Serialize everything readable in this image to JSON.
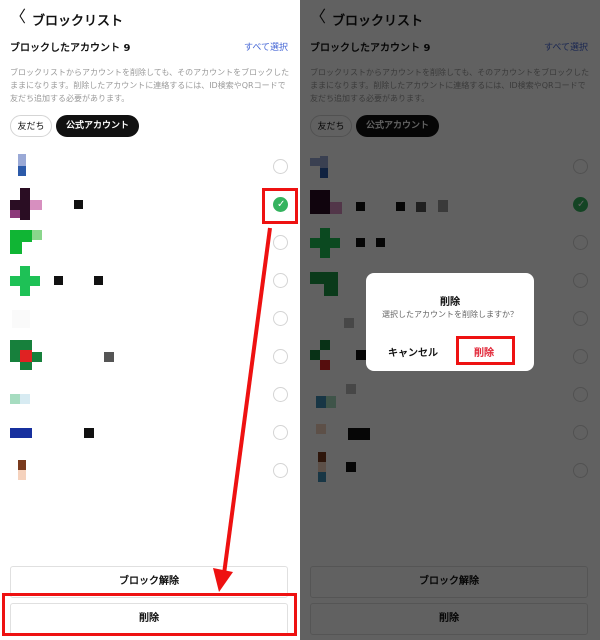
{
  "header": {
    "back_icon": "chevron-left-icon",
    "back_glyph": "〈",
    "title": "ブロックリスト"
  },
  "summary": {
    "count_label": "ブロックしたアカウント 9",
    "select_all": "すべて選択"
  },
  "description": "ブロックリストからアカウントを削除しても、そのアカウントをブロックしたままになります。削除したアカウントに連絡するには、ID検索やQRコードで友だち追加する必要があります。",
  "tabs": [
    {
      "label": "友だち",
      "active": false
    },
    {
      "label": "公式アカウント",
      "active": true
    }
  ],
  "accounts": [
    {
      "avatar": "blurred",
      "selected": false
    },
    {
      "avatar": "blurred",
      "selected": true
    },
    {
      "avatar": "blurred",
      "selected": false
    },
    {
      "avatar": "blurred",
      "selected": false
    },
    {
      "avatar": "blurred",
      "selected": false
    },
    {
      "avatar": "blurred",
      "selected": false
    },
    {
      "avatar": "blurred",
      "selected": false
    },
    {
      "avatar": "blurred",
      "selected": false
    },
    {
      "avatar": "blurred",
      "selected": false
    }
  ],
  "checkmark": "✓",
  "buttons": {
    "unblock": "ブロック解除",
    "delete": "削除"
  },
  "dialog": {
    "title": "削除",
    "message": "選択したアカウントを削除しますか？",
    "cancel": "キャンセル",
    "confirm": "削除"
  },
  "colors": {
    "accent_link": "#4667d6",
    "selected_green": "#35b35f",
    "annotation_red": "#ee1111",
    "delete_red": "#e2293a"
  }
}
